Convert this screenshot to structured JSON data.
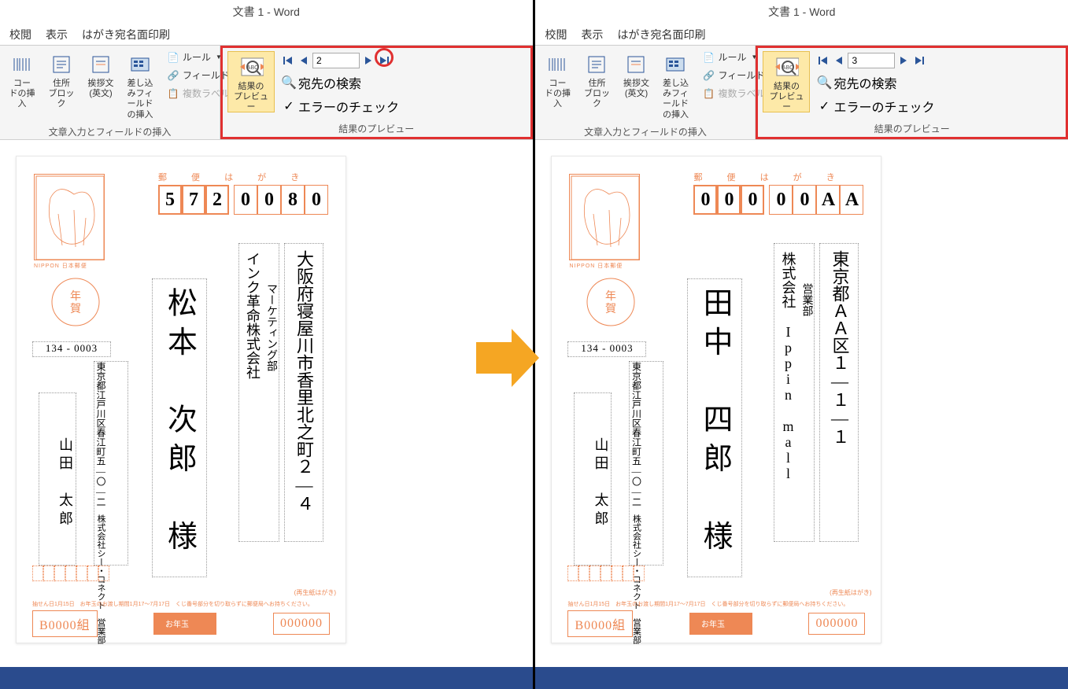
{
  "app_title": "文書 1 - Word",
  "tabs": {
    "review": "校閲",
    "view": "表示",
    "hagaki": "はがき宛名面印刷"
  },
  "ribbon": {
    "code_insert": "コー\nドの挿入",
    "address_block": "住所\nブロック",
    "greeting": "挨拶文\n(英文)",
    "merge_field": "差し込みフィールド\nの挿入",
    "rules": "ルール",
    "match_fields": "フィールドの対応",
    "update_labels": "複数ラベルに反映",
    "group1_label": "文章入力とフィールドの挿入",
    "preview_results": "結果の\nプレビュー",
    "find_recipient": "宛先の検索",
    "check_errors": "エラーのチェック",
    "group2_label": "結果のプレビュー"
  },
  "left": {
    "record_num": "2",
    "postal": [
      "5",
      "7",
      "2",
      "0",
      "0",
      "8",
      "0"
    ],
    "yuubin": "郵 便 は が き",
    "address1": "大阪府寝屋川市香里北之町２―４",
    "company": "インク革命株式会社",
    "dept": "マーケティング部",
    "name": "松本　次郎　様",
    "sender_postal": "134 - 0003",
    "sender_addr1": "東京都江戸川区春江町五―〇―二",
    "sender_company": "株式会社シー・コネクト",
    "sender_dept": "営業部",
    "sender_name": "山田　太郎",
    "nippon": "NIPPON 日本郵便",
    "saisei": "(再生紙はがき)",
    "footer": "抽せん日1月15日　お年玉のお渡し期間1月17～7月17日　くじ番号部分を切り取らずに郵便局へお持ちください。",
    "lottery_left": "B0000組",
    "lottery_right": "000000"
  },
  "right": {
    "record_num": "3",
    "postal": [
      "0",
      "0",
      "0",
      "0",
      "0",
      "A",
      "A"
    ],
    "yuubin": "郵 便 は が き",
    "address1": "東京都ＡＡ区１―１―１",
    "company": "株式会社 Ippin mall",
    "dept": "営業部",
    "name": "田中　四郎　様",
    "sender_postal": "134 - 0003",
    "sender_addr1": "東京都江戸川区春江町五―〇―二",
    "sender_company": "株式会社シー・コネクト",
    "sender_dept": "営業部",
    "sender_name": "山田　太郎",
    "nippon": "NIPPON 日本郵便",
    "saisei": "(再生紙はがき)",
    "footer": "抽せん日1月15日　お年玉のお渡し期間1月17～7月17日　くじ番号部分を切り取らずに郵便局へお持ちください。",
    "lottery_left": "B0000組",
    "lottery_right": "000000"
  }
}
